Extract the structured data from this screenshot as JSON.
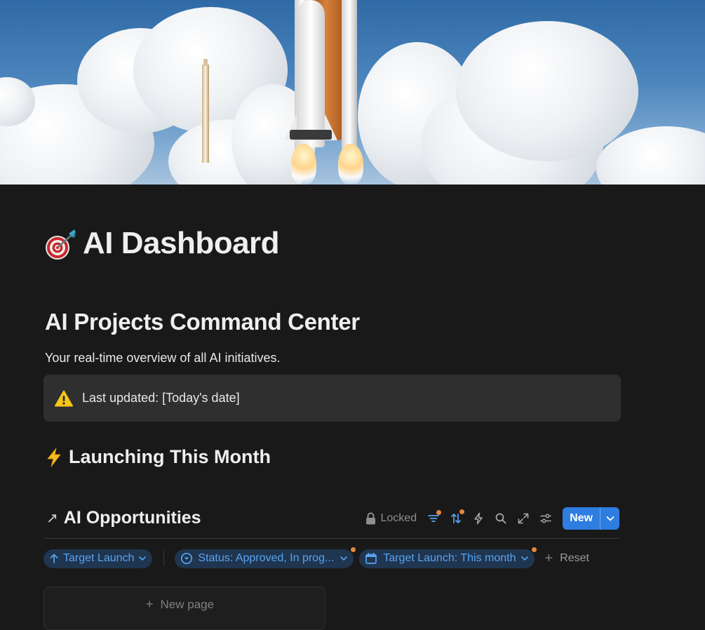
{
  "cover": {
    "image": "space-shuttle-launch"
  },
  "page": {
    "icon": "dart-target-icon",
    "title": "AI Dashboard"
  },
  "section": {
    "heading": "AI Projects Command Center",
    "subtitle": "Your real-time overview of all AI initiatives."
  },
  "callout": {
    "icon": "warning-icon",
    "text": "Last updated: [Today's date]"
  },
  "subheading": {
    "icon": "lightning-icon",
    "text": "Launching This Month"
  },
  "database": {
    "arrow": "↗",
    "title": "AI Opportunities",
    "locked_label": "Locked",
    "new_label": "New",
    "toolbar_icons": [
      "filter-icon",
      "sort-icon",
      "automation-icon",
      "search-icon",
      "expand-icon",
      "settings-icon"
    ],
    "filters": [
      {
        "label": "Target Launch",
        "icon": "arrow-up-icon"
      },
      {
        "label": "Status: Approved, In prog...",
        "icon": "status-icon"
      },
      {
        "label": "Target Launch: This month",
        "icon": "calendar-icon"
      }
    ],
    "reset_label": "Reset",
    "new_page_label": "New page"
  },
  "colors": {
    "background": "#191919",
    "accent": "#2e7de0",
    "chip_bg": "#1f3550",
    "chip_text": "#5aa3ee",
    "indicator": "#e3893c",
    "callout_bg": "#2f2f2f"
  }
}
